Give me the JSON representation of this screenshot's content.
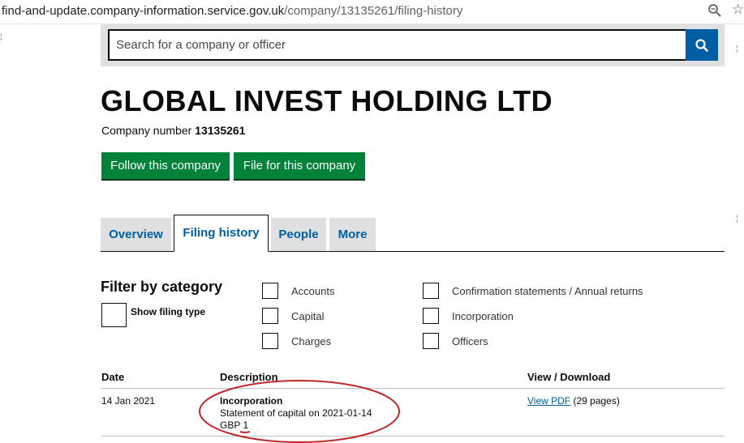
{
  "browser": {
    "url_host": "find-and-update.company-information.service.gov.uk",
    "url_path": "/company/13135261/filing-history",
    "zoom_icon": "zoom-icon",
    "bookmark_icon": "star-icon"
  },
  "search": {
    "placeholder": "Search for a company or officer",
    "button_icon": "search-icon"
  },
  "company": {
    "name": "GLOBAL INVEST HOLDING LTD",
    "number_label": "Company number",
    "number": "13135261"
  },
  "actions": {
    "follow": "Follow this company",
    "file": "File for this company"
  },
  "tabs": [
    {
      "label": "Overview",
      "active": false
    },
    {
      "label": "Filing history",
      "active": true
    },
    {
      "label": "People",
      "active": false
    },
    {
      "label": "More",
      "active": false
    }
  ],
  "filter": {
    "title": "Filter by category",
    "show_filing_type": "Show filing type",
    "categories": [
      "Accounts",
      "Capital",
      "Charges",
      "Confirmation statements / Annual returns",
      "Incorporation",
      "Officers"
    ]
  },
  "table": {
    "headers": [
      "Date",
      "Description",
      "View / Download"
    ],
    "rows": [
      {
        "date": "14 Jan 2021",
        "type": "Incorporation",
        "detail": "Statement of capital on 2021-01-14",
        "currency": "GBP 1",
        "link": "View PDF",
        "pages": "(29 pages)"
      }
    ]
  },
  "colors": {
    "link_blue": "#005ea5",
    "action_green": "#00823b",
    "annotation_red": "#c0282b"
  }
}
